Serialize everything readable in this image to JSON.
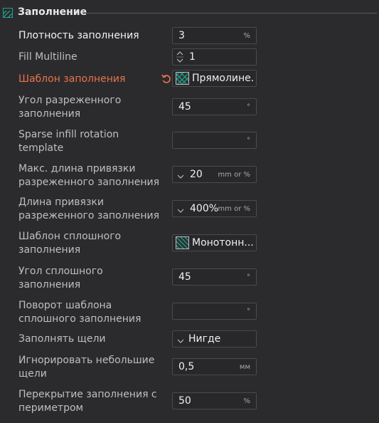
{
  "section": {
    "title": "Заполнение",
    "icon": "infill-icon",
    "accent_color": "#1fa38f"
  },
  "rows": [
    {
      "label": "Плотность заполнения",
      "value": "3",
      "unit": "%"
    },
    {
      "label": "Fill Multiline",
      "value": "1"
    },
    {
      "label": "Шаблон заполнения",
      "value": "Прямолине..."
    },
    {
      "label": "Угол разреженного заполнения",
      "value": "45",
      "unit": "°"
    },
    {
      "label": "Sparse infill rotation template",
      "value": "",
      "unit": "°"
    },
    {
      "label": "Макс. длина привязки разреженного заполнения",
      "value": "20",
      "unit": "mm or %"
    },
    {
      "label": "Длина привязки разреженного заполнения",
      "value": "400%",
      "unit": "mm or %"
    },
    {
      "label": "Шаблон сплошного заполнения",
      "value": "Монотонн..."
    },
    {
      "label": "Угол сплошного заполнения",
      "value": "45",
      "unit": "°"
    },
    {
      "label": "Поворот шаблона сплошного заполнения",
      "value": "",
      "unit": "°"
    },
    {
      "label": "Заполнять щели",
      "value": "Нигде"
    },
    {
      "label": "Игнорировать небольшие щели",
      "value": "0,5",
      "unit": "мм"
    },
    {
      "label": "Перекрытие заполнения с периметром",
      "value": "50",
      "unit": "%"
    }
  ],
  "colors": {
    "modified_label": "#e8734a",
    "background": "#2b2b2e"
  }
}
